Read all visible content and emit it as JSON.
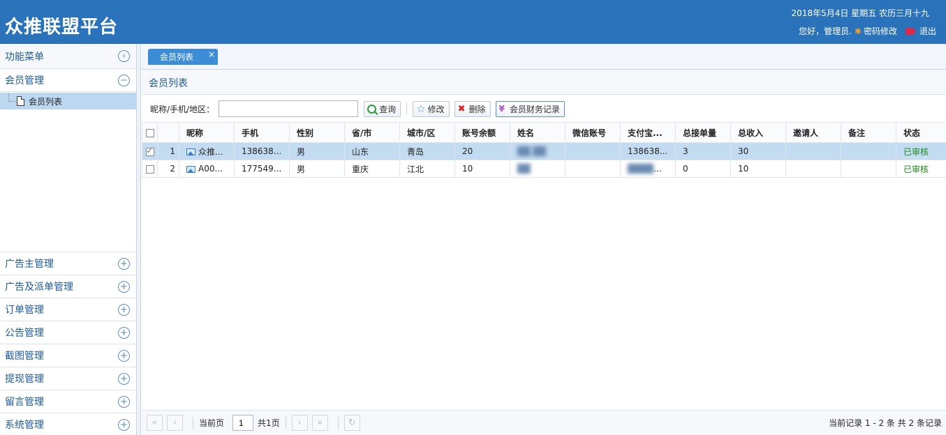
{
  "header": {
    "title": "众推联盟平台",
    "date": "2018年5月4日 星期五 农历三月十九",
    "greeting": "您好，管理员.",
    "change_password": "密码修改",
    "logout": "退出"
  },
  "sidebar": {
    "title": "功能菜单",
    "groups_top": [
      {
        "label": "会员管理",
        "expanded": true,
        "items": [
          {
            "label": "会员列表"
          }
        ]
      }
    ],
    "groups_bottom": [
      {
        "label": "广告主管理"
      },
      {
        "label": "广告及派单管理"
      },
      {
        "label": "订单管理"
      },
      {
        "label": "公告管理"
      },
      {
        "label": "截图管理"
      },
      {
        "label": "提现管理"
      },
      {
        "label": "留言管理"
      },
      {
        "label": "系统管理"
      }
    ]
  },
  "tabs": [
    {
      "label": "会员列表",
      "close": "×"
    }
  ],
  "panel": {
    "title": "会员列表"
  },
  "toolbar": {
    "search_label": "昵称/手机/地区：",
    "search_value": "",
    "query": "查询",
    "edit": "修改",
    "delete": "删除",
    "finance": "会员财务记录"
  },
  "grid": {
    "columns": [
      "昵称",
      "手机",
      "性别",
      "省/市",
      "城市/区",
      "账号余额",
      "姓名",
      "微信账号",
      "支付宝...",
      "总接单量",
      "总收入",
      "邀请人",
      "备注",
      "状态"
    ],
    "rows": [
      {
        "num": "1",
        "checked": true,
        "nickname": "众推...",
        "phone": "138638...",
        "gender": "男",
        "province": "山东",
        "city": "青岛",
        "balance": "20",
        "name": "",
        "wechat": "",
        "alipay": "138638...",
        "orders": "3",
        "income": "30",
        "inviter": "",
        "remark": "",
        "status": "已审核"
      },
      {
        "num": "2",
        "checked": false,
        "nickname": "A00...",
        "phone": "177549...",
        "gender": "男",
        "province": "重庆",
        "city": "江北",
        "balance": "10",
        "name": "",
        "wechat": "",
        "alipay": "",
        "orders": "0",
        "income": "10",
        "inviter": "",
        "remark": "",
        "status": "已审核"
      }
    ]
  },
  "pager": {
    "current_label": "当前页",
    "current_page": "1",
    "total_pages": "共1页",
    "info": "当前记录 1 - 2 条 共 2 条记录"
  }
}
